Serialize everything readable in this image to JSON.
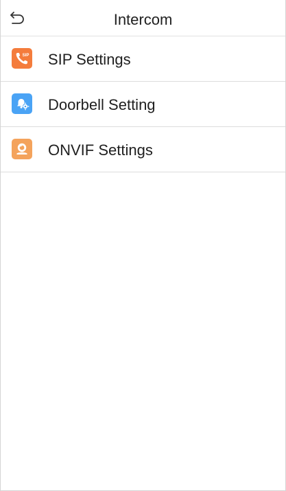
{
  "header": {
    "title": "Intercom",
    "back_icon": "back-arrow-icon"
  },
  "menu": {
    "items": [
      {
        "label": "SIP Settings",
        "icon": "sip-phone-icon",
        "icon_color": "#f47c3c",
        "icon_text": "SIP"
      },
      {
        "label": "Doorbell Setting",
        "icon": "doorbell-settings-icon",
        "icon_color": "#4aa3f5"
      },
      {
        "label": "ONVIF Settings",
        "icon": "onvif-camera-icon",
        "icon_color": "#f4a35c"
      }
    ]
  }
}
